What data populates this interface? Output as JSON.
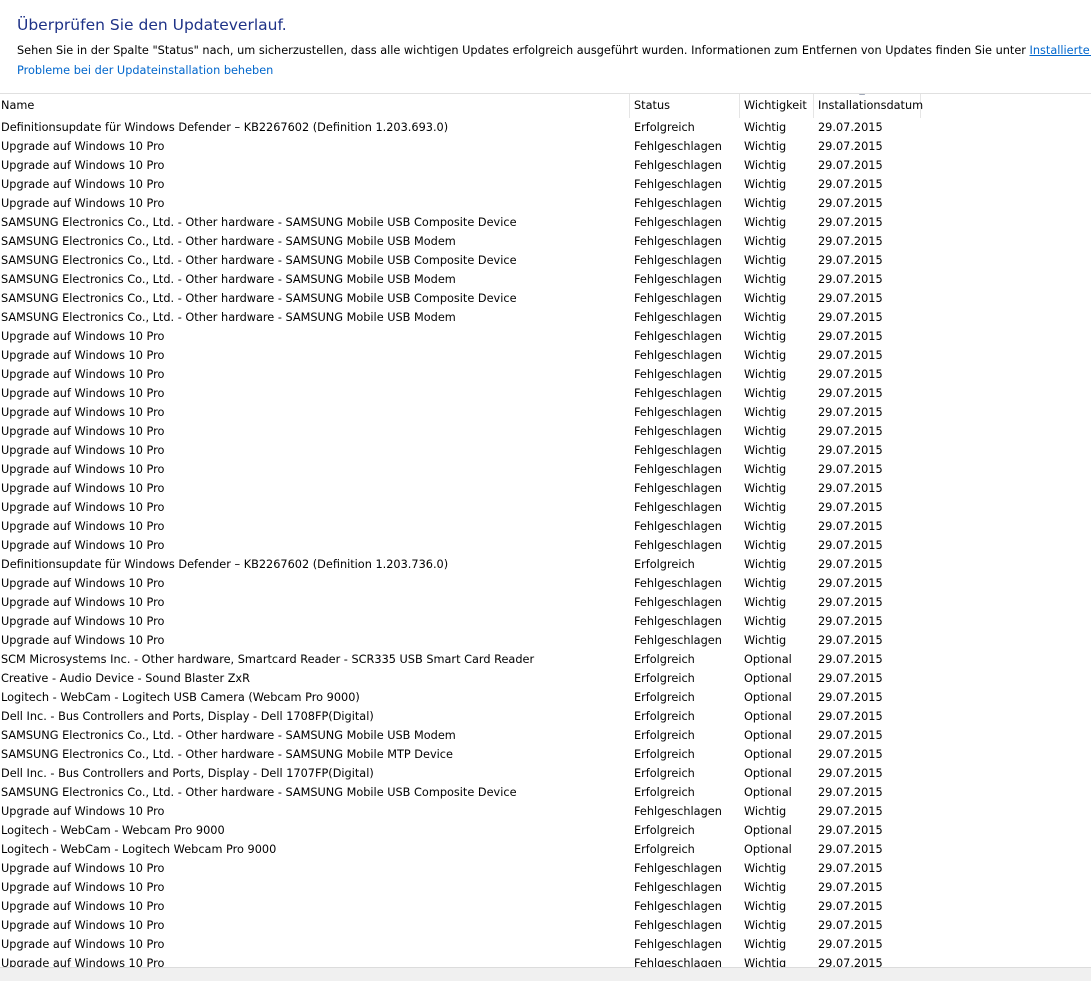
{
  "header": {
    "title": "Überprüfen Sie den Updateverlauf.",
    "description": "Sehen Sie in der Spalte \"Status\" nach, um sicherzustellen, dass alle wichtigen Updates erfolgreich ausgeführt wurden. Informationen zum Entfernen von Updates finden Sie unter ",
    "installed_updates_link": "Installierte Updates",
    "description_end": ".",
    "troubleshoot_link": "Probleme bei der Updateinstallation beheben"
  },
  "table": {
    "columns": [
      {
        "key": "name",
        "label": "Name"
      },
      {
        "key": "status",
        "label": "Status"
      },
      {
        "key": "importance",
        "label": "Wichtigkeit"
      },
      {
        "key": "date",
        "label": "Installationsdatum"
      }
    ],
    "sort_icon": "sort-up-icon",
    "rows": [
      [
        "Definitionsupdate für Windows Defender – KB2267602 (Definition 1.203.693.0)",
        "Erfolgreich",
        "Wichtig",
        "29.07.2015"
      ],
      [
        "Upgrade auf Windows 10 Pro",
        "Fehlgeschlagen",
        "Wichtig",
        "29.07.2015"
      ],
      [
        "Upgrade auf Windows 10 Pro",
        "Fehlgeschlagen",
        "Wichtig",
        "29.07.2015"
      ],
      [
        "Upgrade auf Windows 10 Pro",
        "Fehlgeschlagen",
        "Wichtig",
        "29.07.2015"
      ],
      [
        "Upgrade auf Windows 10 Pro",
        "Fehlgeschlagen",
        "Wichtig",
        "29.07.2015"
      ],
      [
        "SAMSUNG Electronics Co., Ltd. - Other hardware - SAMSUNG Mobile USB Composite Device",
        "Fehlgeschlagen",
        "Wichtig",
        "29.07.2015"
      ],
      [
        "SAMSUNG Electronics Co., Ltd. - Other hardware - SAMSUNG Mobile USB Modem",
        "Fehlgeschlagen",
        "Wichtig",
        "29.07.2015"
      ],
      [
        "SAMSUNG Electronics Co., Ltd. - Other hardware - SAMSUNG Mobile USB Composite Device",
        "Fehlgeschlagen",
        "Wichtig",
        "29.07.2015"
      ],
      [
        "SAMSUNG Electronics Co., Ltd. - Other hardware - SAMSUNG Mobile USB Modem",
        "Fehlgeschlagen",
        "Wichtig",
        "29.07.2015"
      ],
      [
        "SAMSUNG Electronics Co., Ltd. - Other hardware - SAMSUNG Mobile USB Composite Device",
        "Fehlgeschlagen",
        "Wichtig",
        "29.07.2015"
      ],
      [
        "SAMSUNG Electronics Co., Ltd. - Other hardware - SAMSUNG Mobile USB Modem",
        "Fehlgeschlagen",
        "Wichtig",
        "29.07.2015"
      ],
      [
        "Upgrade auf Windows 10 Pro",
        "Fehlgeschlagen",
        "Wichtig",
        "29.07.2015"
      ],
      [
        "Upgrade auf Windows 10 Pro",
        "Fehlgeschlagen",
        "Wichtig",
        "29.07.2015"
      ],
      [
        "Upgrade auf Windows 10 Pro",
        "Fehlgeschlagen",
        "Wichtig",
        "29.07.2015"
      ],
      [
        "Upgrade auf Windows 10 Pro",
        "Fehlgeschlagen",
        "Wichtig",
        "29.07.2015"
      ],
      [
        "Upgrade auf Windows 10 Pro",
        "Fehlgeschlagen",
        "Wichtig",
        "29.07.2015"
      ],
      [
        "Upgrade auf Windows 10 Pro",
        "Fehlgeschlagen",
        "Wichtig",
        "29.07.2015"
      ],
      [
        "Upgrade auf Windows 10 Pro",
        "Fehlgeschlagen",
        "Wichtig",
        "29.07.2015"
      ],
      [
        "Upgrade auf Windows 10 Pro",
        "Fehlgeschlagen",
        "Wichtig",
        "29.07.2015"
      ],
      [
        "Upgrade auf Windows 10 Pro",
        "Fehlgeschlagen",
        "Wichtig",
        "29.07.2015"
      ],
      [
        "Upgrade auf Windows 10 Pro",
        "Fehlgeschlagen",
        "Wichtig",
        "29.07.2015"
      ],
      [
        "Upgrade auf Windows 10 Pro",
        "Fehlgeschlagen",
        "Wichtig",
        "29.07.2015"
      ],
      [
        "Upgrade auf Windows 10 Pro",
        "Fehlgeschlagen",
        "Wichtig",
        "29.07.2015"
      ],
      [
        "Definitionsupdate für Windows Defender – KB2267602 (Definition 1.203.736.0)",
        "Erfolgreich",
        "Wichtig",
        "29.07.2015"
      ],
      [
        "Upgrade auf Windows 10 Pro",
        "Fehlgeschlagen",
        "Wichtig",
        "29.07.2015"
      ],
      [
        "Upgrade auf Windows 10 Pro",
        "Fehlgeschlagen",
        "Wichtig",
        "29.07.2015"
      ],
      [
        "Upgrade auf Windows 10 Pro",
        "Fehlgeschlagen",
        "Wichtig",
        "29.07.2015"
      ],
      [
        "Upgrade auf Windows 10 Pro",
        "Fehlgeschlagen",
        "Wichtig",
        "29.07.2015"
      ],
      [
        "SCM Microsystems Inc. - Other hardware, Smartcard Reader - SCR335 USB Smart Card Reader",
        "Erfolgreich",
        "Optional",
        "29.07.2015"
      ],
      [
        "Creative - Audio Device - Sound Blaster ZxR",
        "Erfolgreich",
        "Optional",
        "29.07.2015"
      ],
      [
        "Logitech - WebCam - Logitech USB Camera (Webcam Pro 9000)",
        "Erfolgreich",
        "Optional",
        "29.07.2015"
      ],
      [
        "Dell Inc. - Bus Controllers and Ports, Display - Dell 1708FP(Digital)",
        "Erfolgreich",
        "Optional",
        "29.07.2015"
      ],
      [
        "SAMSUNG Electronics Co., Ltd. - Other hardware - SAMSUNG Mobile USB Modem",
        "Erfolgreich",
        "Optional",
        "29.07.2015"
      ],
      [
        "SAMSUNG Electronics Co., Ltd. - Other hardware - SAMSUNG Mobile MTP Device",
        "Erfolgreich",
        "Optional",
        "29.07.2015"
      ],
      [
        "Dell Inc. - Bus Controllers and Ports, Display - Dell 1707FP(Digital)",
        "Erfolgreich",
        "Optional",
        "29.07.2015"
      ],
      [
        "SAMSUNG Electronics Co., Ltd. - Other hardware - SAMSUNG Mobile USB Composite Device",
        "Erfolgreich",
        "Optional",
        "29.07.2015"
      ],
      [
        "Upgrade auf Windows 10 Pro",
        "Fehlgeschlagen",
        "Wichtig",
        "29.07.2015"
      ],
      [
        "Logitech - WebCam - Webcam Pro 9000",
        "Erfolgreich",
        "Optional",
        "29.07.2015"
      ],
      [
        "Logitech - WebCam - Logitech Webcam Pro 9000",
        "Erfolgreich",
        "Optional",
        "29.07.2015"
      ],
      [
        "Upgrade auf Windows 10 Pro",
        "Fehlgeschlagen",
        "Wichtig",
        "29.07.2015"
      ],
      [
        "Upgrade auf Windows 10 Pro",
        "Fehlgeschlagen",
        "Wichtig",
        "29.07.2015"
      ],
      [
        "Upgrade auf Windows 10 Pro",
        "Fehlgeschlagen",
        "Wichtig",
        "29.07.2015"
      ],
      [
        "Upgrade auf Windows 10 Pro",
        "Fehlgeschlagen",
        "Wichtig",
        "29.07.2015"
      ],
      [
        "Upgrade auf Windows 10 Pro",
        "Fehlgeschlagen",
        "Wichtig",
        "29.07.2015"
      ],
      [
        "Upgrade auf Windows 10 Pro",
        "Fehlgeschlagen",
        "Wichtig",
        "29.07.2015"
      ]
    ]
  },
  "colors": {
    "title": "#1e3287",
    "link": "#0066cc"
  }
}
